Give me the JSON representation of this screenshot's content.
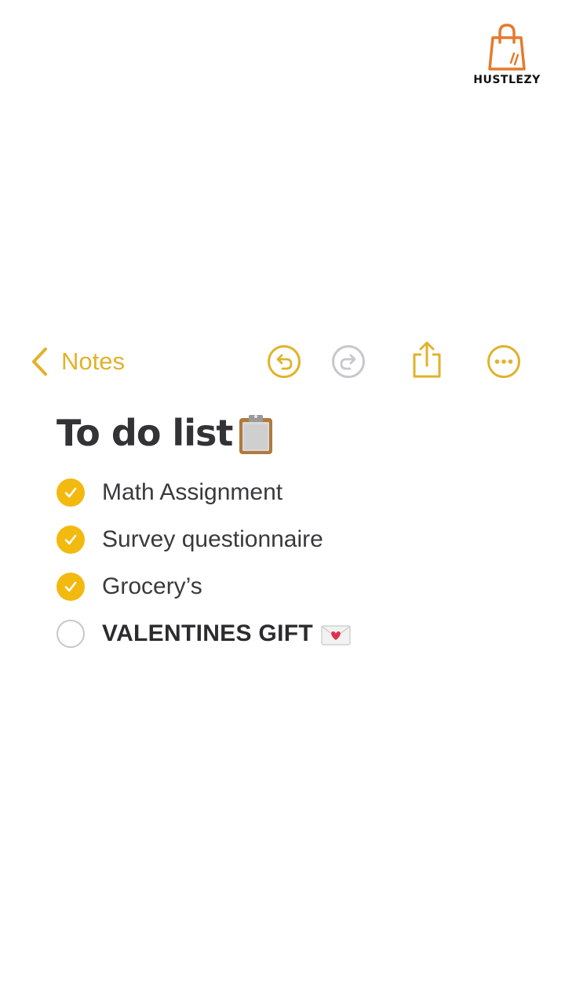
{
  "brand": {
    "name": "HUSTLEZY"
  },
  "toolbar": {
    "back_label": "Notes",
    "icons": [
      "chevron-left-icon",
      "undo-icon",
      "redo-icon",
      "share-icon",
      "more-icon"
    ],
    "accent_color": "#e1b22a"
  },
  "note": {
    "title": "To do list",
    "title_emoji": "clipboard-icon",
    "items": [
      {
        "text": "Math Assignment",
        "checked": true
      },
      {
        "text": "Survey questionnaire",
        "checked": true
      },
      {
        "text": "Grocery’s",
        "checked": true
      },
      {
        "text": "VALENTINES GIFT",
        "checked": false,
        "emoji": "love-letter-icon"
      }
    ]
  },
  "colors": {
    "checkbox_checked": "#f2b90f",
    "checkbox_unchecked_border": "#c7c7cc",
    "text": "#3a3a3c"
  }
}
